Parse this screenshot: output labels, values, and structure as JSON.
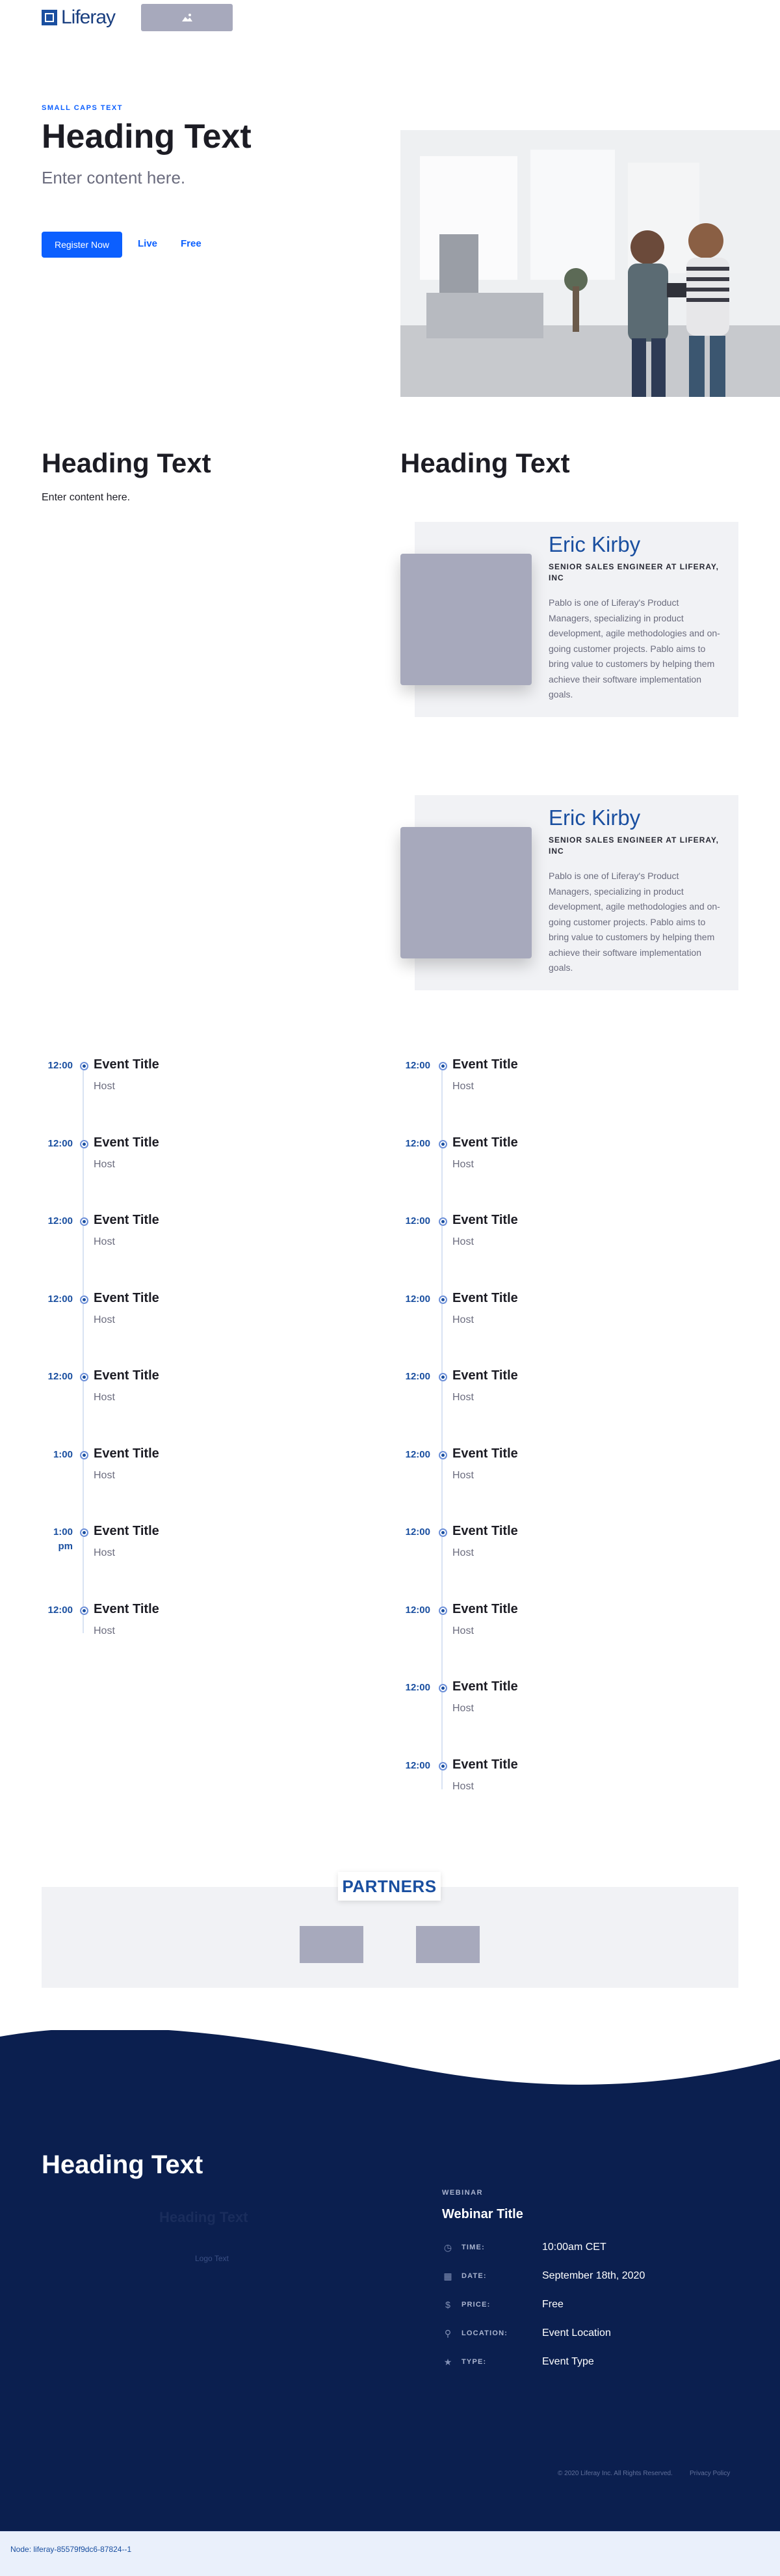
{
  "header": {
    "logo_text": "Liferay",
    "image_placeholder_icon": "image-icon"
  },
  "hero": {
    "eyebrow": "SMALL CAPS TEXT",
    "title": "Heading Text",
    "subtitle": "Enter content here.",
    "register_label": "Register Now",
    "link_live": "Live",
    "link_free": "Free"
  },
  "intro": {
    "title": "Heading Text",
    "body": "Enter content here."
  },
  "speakers": {
    "title": "Heading Text",
    "items": [
      {
        "name": "Eric Kirby",
        "role": "SENIOR SALES ENGINEER AT LIFERAY, INC",
        "bio": "Pablo is one of Liferay's Product Managers, specializing in product development, agile methodologies and on-going customer projects. Pablo aims to bring value to customers by helping them achieve their software implementation goals."
      },
      {
        "name": "Eric Kirby",
        "role": "SENIOR SALES ENGINEER AT LIFERAY, INC",
        "bio": "Pablo is one of Liferay's Product Managers, specializing in product development, agile methodologies and on-going customer projects. Pablo aims to bring value to customers by helping them achieve their software implementation goals."
      }
    ]
  },
  "agenda": {
    "left": [
      {
        "time": "12:00",
        "title": "Event Title",
        "host": "Host"
      },
      {
        "time": "12:00",
        "title": "Event Title",
        "host": "Host"
      },
      {
        "time": "12:00",
        "title": "Event Title",
        "host": "Host"
      },
      {
        "time": "12:00",
        "title": "Event Title",
        "host": "Host"
      },
      {
        "time": "12:00",
        "title": "Event Title",
        "host": "Host"
      },
      {
        "time": "1:00",
        "title": "Event Title",
        "host": "Host"
      },
      {
        "time": "1:00 pm",
        "title": "Event Title",
        "host": "Host"
      },
      {
        "time": "12:00",
        "title": "Event Title",
        "host": "Host"
      }
    ],
    "right": [
      {
        "time": "12:00",
        "title": "Event Title",
        "host": "Host"
      },
      {
        "time": "12:00",
        "title": "Event Title",
        "host": "Host"
      },
      {
        "time": "12:00",
        "title": "Event Title",
        "host": "Host"
      },
      {
        "time": "12:00",
        "title": "Event Title",
        "host": "Host"
      },
      {
        "time": "12:00",
        "title": "Event Title",
        "host": "Host"
      },
      {
        "time": "12:00",
        "title": "Event Title",
        "host": "Host"
      },
      {
        "time": "12:00",
        "title": "Event Title",
        "host": "Host"
      },
      {
        "time": "12:00",
        "title": "Event Title",
        "host": "Host"
      },
      {
        "time": "12:00",
        "title": "Event Title",
        "host": "Host"
      },
      {
        "time": "12:00",
        "title": "Event Title",
        "host": "Host"
      }
    ]
  },
  "partners": {
    "label": "PARTNERS"
  },
  "footer": {
    "title": "Heading Text",
    "ghost_heading": "Heading Text",
    "ghost_caption": "Logo Text",
    "webinar_eyebrow": "WEBINAR",
    "webinar_title": "Webinar Title",
    "details": [
      {
        "icon": "clock-icon",
        "glyph": "◷",
        "label": "TIME:",
        "value": "10:00am CET"
      },
      {
        "icon": "calendar-icon",
        "glyph": "▦",
        "label": "DATE:",
        "value": "September 18th, 2020"
      },
      {
        "icon": "dollar-icon",
        "glyph": "$",
        "label": "PRICE:",
        "value": "Free"
      },
      {
        "icon": "location-pin-icon",
        "glyph": "⚲",
        "label": "LOCATION:",
        "value": "Event Location"
      },
      {
        "icon": "star-icon",
        "glyph": "★",
        "label": "TYPE:",
        "value": "Event Type"
      }
    ],
    "copyright": "© 2020 Liferay Inc. All Rights Reserved.",
    "privacy": "Privacy Policy"
  },
  "node_info": "Node: liferay-85579f9dc6-87824--1",
  "colors": {
    "primary": "#0b5fff",
    "brand_dark": "#0b1f4f",
    "heading_blue": "#1a4fa0",
    "placeholder": "#a7a9bc"
  }
}
